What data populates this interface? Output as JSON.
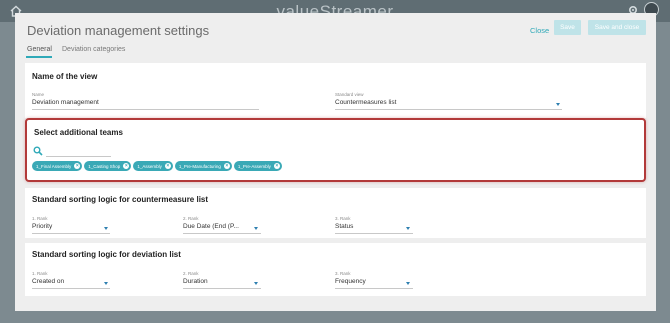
{
  "app": {
    "brand": "valueStreamer"
  },
  "modal": {
    "title": "Deviation management settings",
    "close_label": "Close",
    "save_label": "Save",
    "save_close_label": "Save and close",
    "tabs": [
      {
        "label": "General",
        "active": true
      },
      {
        "label": "Deviation categories",
        "active": false
      }
    ]
  },
  "view_section": {
    "heading": "Name of the view",
    "name_label": "Name",
    "name_value": "Deviation management",
    "standard_view_label": "Standard view",
    "standard_view_value": "Countermeasures list"
  },
  "teams_section": {
    "heading": "Select additional teams",
    "chips": [
      "1_Final Assembly",
      "1_Casting Shop",
      "1_Assembly",
      "1_Pre-Manufacturing",
      "1_Pre-Assembly"
    ]
  },
  "countermeasure_sort": {
    "heading": "Standard sorting logic for countermeasure list",
    "ranks": [
      {
        "label": "1. Rank",
        "value": "Priority"
      },
      {
        "label": "2. Rank",
        "value": "Due Date (End (P..."
      },
      {
        "label": "3. Rank",
        "value": "Status"
      }
    ]
  },
  "deviation_sort": {
    "heading": "Standard sorting logic for deviation list",
    "ranks": [
      {
        "label": "1. Rank",
        "value": "Created on"
      },
      {
        "label": "2. Rank",
        "value": "Duration"
      },
      {
        "label": "3. Rank",
        "value": "Frequency"
      }
    ]
  },
  "colors": {
    "accent": "#2fa9b8",
    "highlight_border": "#b23a3a"
  }
}
